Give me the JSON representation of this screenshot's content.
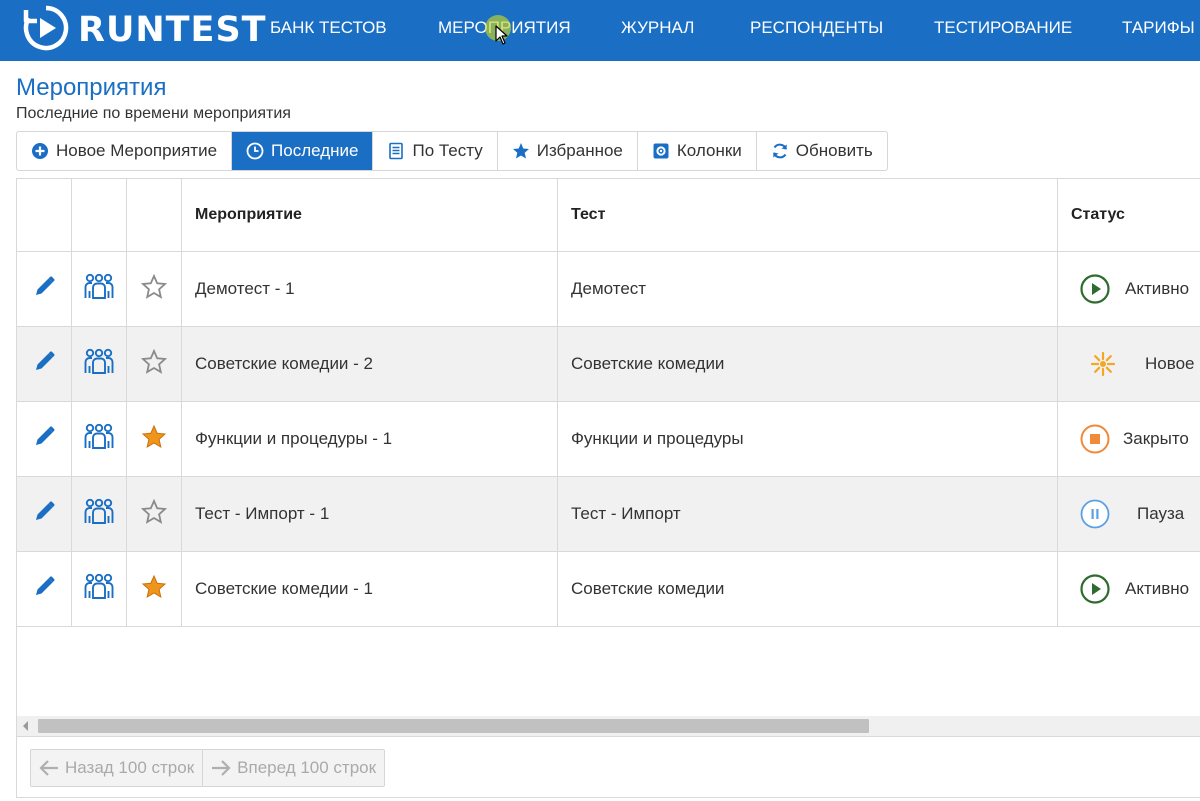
{
  "brand": {
    "name": "RUNTEST"
  },
  "nav": [
    {
      "label": "БАНК ТЕСТОВ"
    },
    {
      "label": "МЕРОПРИЯТИЯ"
    },
    {
      "label": "ЖУРНАЛ"
    },
    {
      "label": "РЕСПОНДЕНТЫ"
    },
    {
      "label": "ТЕСТИРОВАНИЕ"
    },
    {
      "label": "ТАРИФЫ"
    }
  ],
  "page": {
    "title": "Мероприятия",
    "subtitle": "Последние по времени мероприятия"
  },
  "toolbar": [
    {
      "label": "Новое Мероприятие",
      "icon": "plus-circle-icon",
      "active": false
    },
    {
      "label": "Последние",
      "icon": "clock-icon",
      "active": true
    },
    {
      "label": "По Тесту",
      "icon": "document-icon",
      "active": false
    },
    {
      "label": "Избранное",
      "icon": "star-icon",
      "active": false
    },
    {
      "label": "Колонки",
      "icon": "columns-settings-icon",
      "active": false
    },
    {
      "label": "Обновить",
      "icon": "refresh-icon",
      "active": false
    }
  ],
  "table": {
    "columns": [
      "",
      "",
      "",
      "Мероприятие",
      "Тест",
      "Статус"
    ],
    "rows": [
      {
        "event": "Демотест - 1",
        "test": "Демотест",
        "status": "Активно",
        "status_icon": "play-icon",
        "favorite": false
      },
      {
        "event": "Советские комедии - 2",
        "test": "Советские комедии",
        "status": "Новое",
        "status_icon": "sparkle-icon",
        "favorite": false
      },
      {
        "event": "Функции и процедуры - 1",
        "test": "Функции и процедуры",
        "status": "Закрыто",
        "status_icon": "stop-icon",
        "favorite": true
      },
      {
        "event": "Тест - Импорт - 1",
        "test": "Тест - Импорт",
        "status": "Пауза",
        "status_icon": "pause-icon",
        "favorite": false
      },
      {
        "event": "Советские комедии - 1",
        "test": "Советские комедии",
        "status": "Активно",
        "status_icon": "play-icon",
        "favorite": true
      }
    ]
  },
  "pager": {
    "back_label": "Назад 100 строк",
    "forward_label": "Вперед 100 строк"
  },
  "colors": {
    "brand": "#1a6fc4",
    "favorite": "#f0951c",
    "active_status": "#2e6b2e",
    "new_status": "#f5a623",
    "closed_status": "#f08a3a",
    "pause_status": "#5aa0e6"
  }
}
